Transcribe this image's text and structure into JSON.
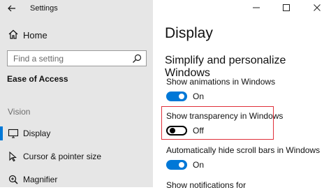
{
  "app": {
    "title": "Settings"
  },
  "sidebar": {
    "home_label": "Home",
    "search_placeholder": "Find a setting",
    "section_title": "Ease of Access",
    "group_label": "Vision",
    "items": [
      {
        "label": "Display",
        "icon": "display-icon",
        "selected": true
      },
      {
        "label": "Cursor & pointer size",
        "icon": "cursor-icon",
        "selected": false
      },
      {
        "label": "Magnifier",
        "icon": "magnifier-icon",
        "selected": false
      }
    ]
  },
  "main": {
    "title": "Display",
    "subtitle": "Simplify and personalize Windows",
    "settings": [
      {
        "title": "Show animations in Windows",
        "state": "On",
        "on": true
      },
      {
        "title": "Show transparency in Windows",
        "state": "Off",
        "on": false
      },
      {
        "title": "Automatically hide scroll bars in Windows",
        "state": "On",
        "on": true
      },
      {
        "title": "Show notifications for"
      }
    ]
  },
  "colors": {
    "accent": "#0078d7",
    "sidebar_bg": "#e6e6e6",
    "highlight": "#e0303a"
  }
}
